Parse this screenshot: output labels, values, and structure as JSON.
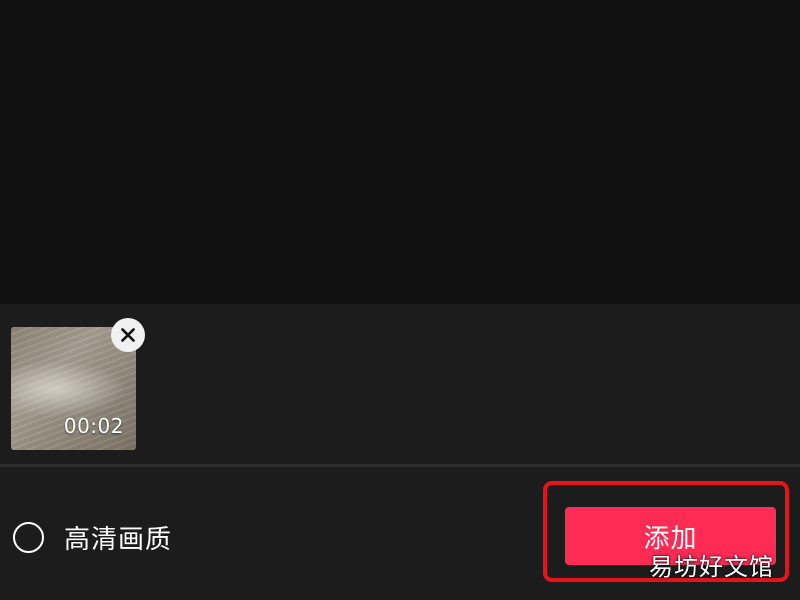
{
  "selected_clips": [
    {
      "duration": "00:02",
      "remove_icon": "close-icon"
    }
  ],
  "hd_option": {
    "label": "高清画质",
    "checked": false
  },
  "add_button": {
    "label": "添加"
  },
  "watermark": {
    "text": "易坊好文馆"
  },
  "colors": {
    "background": "#121212",
    "panel": "#1c1c1c",
    "accent": "#fe2c55",
    "annotation_box": "#e8131a",
    "text": "#ffffff"
  }
}
